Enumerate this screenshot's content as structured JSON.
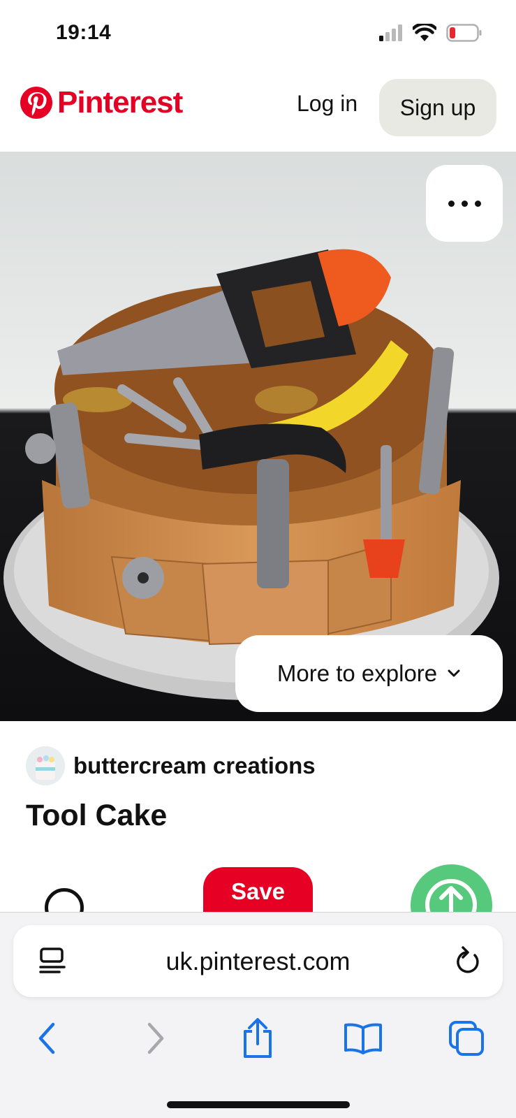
{
  "status_bar": {
    "time": "19:14",
    "icons": [
      "cellular-signal-icon",
      "wifi-icon",
      "battery-low-icon"
    ]
  },
  "header": {
    "brand": "Pinterest",
    "login_label": "Log in",
    "signup_label": "Sign up"
  },
  "pin": {
    "image_alt": "Tool belt cake with fondant saw, hammer, nails, tape measure, wrench and screwdriver",
    "more_explore_label": "More to explore",
    "creator_name": "buttercream creations",
    "title": "Tool Cake",
    "save_label": "Save"
  },
  "browser": {
    "url": "uk.pinterest.com"
  },
  "colors": {
    "brand_red": "#e60023",
    "signup_bg": "#e9e9e4",
    "share_green": "#56c97d",
    "safari_blue": "#1a73e8"
  }
}
